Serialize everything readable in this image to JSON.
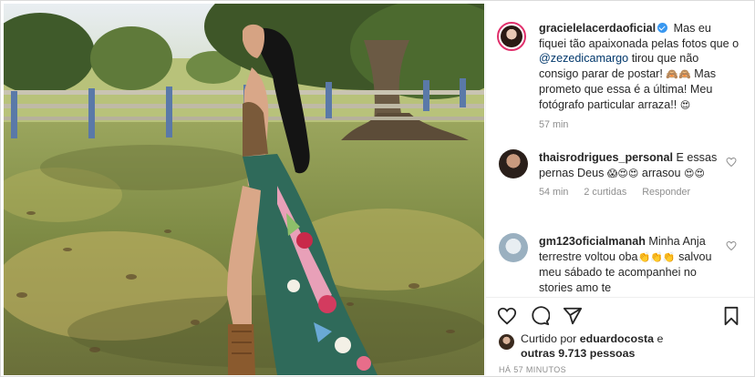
{
  "post": {
    "author": "gracielelacerdaoficial",
    "caption_a": "Mas eu fiquei tão apaixonada pelas fotos que o",
    "caption_mention": "@zezedicamargo",
    "caption_b": "tirou que não consigo parar de postar!",
    "caption_emoji_a": "🙈🙈",
    "caption_c": "Mas prometo que essa é a última! Meu fotógrafo particular arraza!!",
    "caption_emoji_b": "😍",
    "time": "57 min"
  },
  "comments": [
    {
      "user": "thaisrodrigues_personal",
      "text_a": "E essas pernas Deus",
      "emoji_a": "😱😍😍",
      "text_b": "arrasou",
      "emoji_b": "😍😍",
      "time": "54 min",
      "likes": "2 curtidas",
      "reply": "Responder"
    },
    {
      "user": "gm123oficialmanah",
      "text_a": "Minha Anja terrestre voltou oba",
      "emoji_a": "👏👏👏",
      "text_b": "salvou meu sábado te acompanhei no stories amo te"
    }
  ],
  "likes": {
    "prefix": "Curtido por",
    "user": "eduardocosta",
    "and": "e",
    "others": "outras 9.713 pessoas"
  },
  "timestamp": "HÁ 57 MINUTOS",
  "icons": [
    "heart-icon",
    "comment-icon",
    "share-icon",
    "bookmark-icon"
  ],
  "colors": {
    "mention": "#00376b",
    "verified": "#3897f0",
    "meta": "#8e8e8e"
  }
}
